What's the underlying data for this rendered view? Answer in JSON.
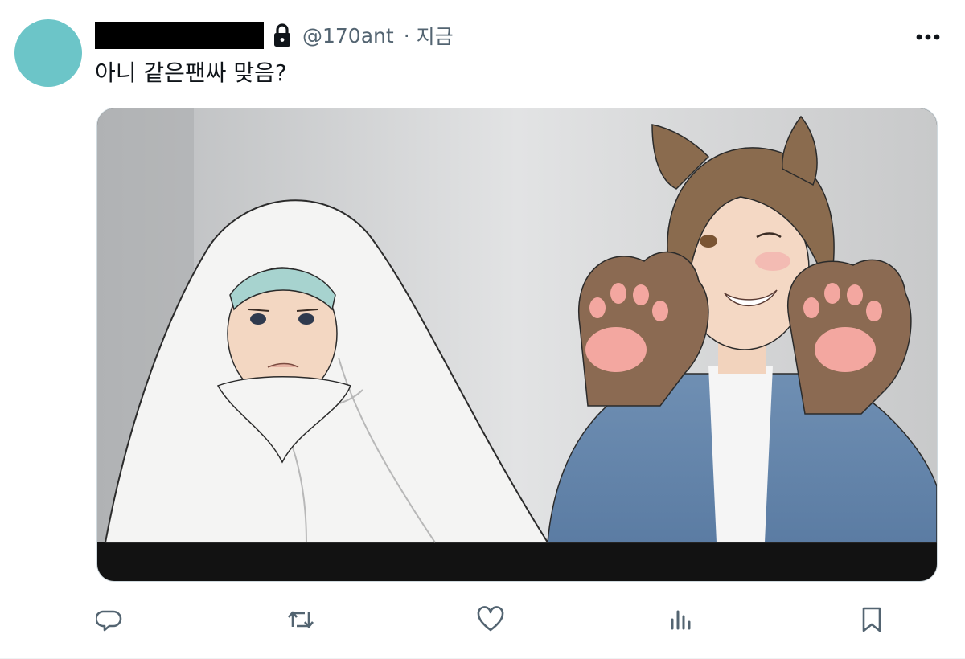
{
  "tweet": {
    "author_name": "",
    "handle": "@170ant",
    "separator": "·",
    "time": "지금",
    "text": "아니 같은팬싸 맞음?"
  },
  "colors": {
    "avatar": "#6cc5c8",
    "secondary_text": "#536471",
    "icon": "#536471"
  },
  "media": {
    "description": "Illustrated webtoon panel: left character wrapped in a white blanket with a teal headband; right character with cat ears and brown cat-paw gloves in a blue jacket."
  },
  "actions": [
    {
      "name": "reply",
      "icon": "reply-icon"
    },
    {
      "name": "retweet",
      "icon": "retweet-icon"
    },
    {
      "name": "like",
      "icon": "heart-icon"
    },
    {
      "name": "views",
      "icon": "analytics-icon"
    },
    {
      "name": "bookmark",
      "icon": "bookmark-icon"
    }
  ]
}
